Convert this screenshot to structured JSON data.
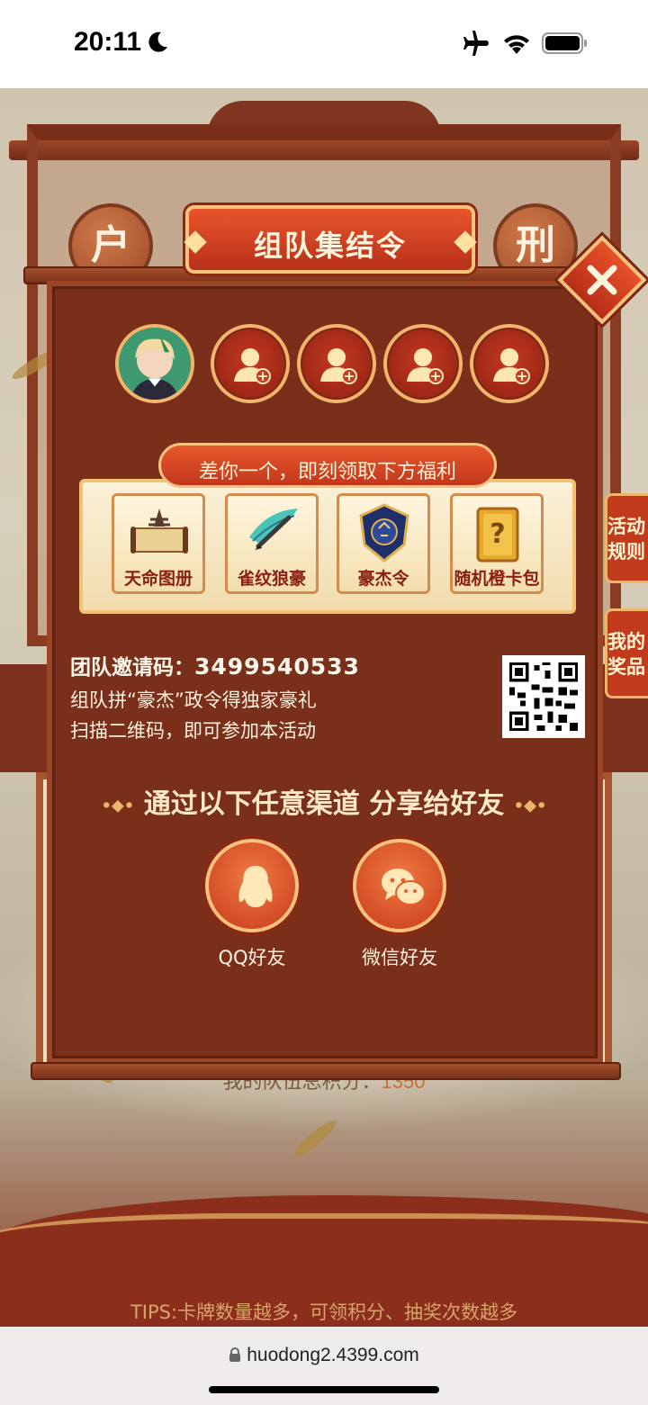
{
  "status_bar": {
    "time": "20:11"
  },
  "modal": {
    "title": "组队集结令",
    "benefit_banner": "差你一个，即刻领取下方福利",
    "benefits": [
      {
        "label": "天命图册",
        "icon": "scroll-pagoda-icon"
      },
      {
        "label": "雀纹狼豪",
        "icon": "brush-feather-icon"
      },
      {
        "label": "豪杰令",
        "icon": "emblem-token-icon"
      },
      {
        "label": "随机橙卡包",
        "icon": "mystery-card-icon"
      }
    ],
    "invite_code_label": "团队邀请码：",
    "invite_code": "3499540533",
    "invite_line1": "组队拼“豪杰”政令得独家豪礼",
    "invite_line2": "扫描二维码，即可参加本活动",
    "share_title": "通过以下任意渠道 分享给好友",
    "share_deco_left": "•◆•",
    "share_deco_right": "•◆•",
    "share_qq": "QQ好友",
    "share_wechat": "微信好友"
  },
  "background": {
    "coin_left": "户",
    "coin_right": "刑",
    "side_rules": "活动规则",
    "side_prizes": "我的奖品",
    "team_score_label": "我的队伍总积分：",
    "team_score_value": "1350",
    "tips": "TIPS:卡牌数量越多，可领积分、抽奖次数越多"
  },
  "browser": {
    "url": "huodong2.4399.com"
  },
  "colors": {
    "modal_bg": "#7a2f1b",
    "accent": "#e8552b",
    "gold": "#f6c27c"
  }
}
